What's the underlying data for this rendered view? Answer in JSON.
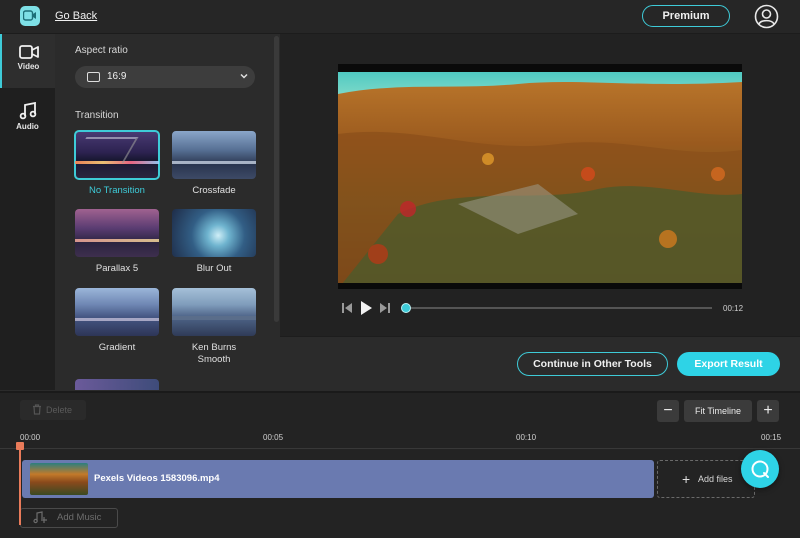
{
  "header": {
    "back_label": "Go Back",
    "premium_label": "Premium"
  },
  "rail": {
    "items": [
      {
        "label": "Video",
        "icon": "video-camera-icon",
        "active": true
      },
      {
        "label": "Audio",
        "icon": "music-note-icon",
        "active": false
      }
    ]
  },
  "panel": {
    "aspect_title": "Aspect ratio",
    "aspect_value": "16:9",
    "transition_title": "Transition",
    "transitions": [
      {
        "label": "No Transition",
        "selected": true
      },
      {
        "label": "Crossfade",
        "selected": false
      },
      {
        "label": "Parallax 5",
        "selected": false
      },
      {
        "label": "Blur Out",
        "selected": false
      },
      {
        "label": "Gradient",
        "selected": false
      },
      {
        "label": "Ken Burns Smooth",
        "selected": false
      }
    ]
  },
  "player": {
    "duration": "00:12",
    "progress": 0
  },
  "actions": {
    "continue_label": "Continue in Other Tools",
    "export_label": "Export Result"
  },
  "timeline": {
    "delete_label": "Delete",
    "fit_label": "Fit Timeline",
    "zoom_out_symbol": "−",
    "zoom_in_symbol": "+",
    "ticks": [
      "00:00",
      "00:05",
      "00:10",
      "00:15"
    ],
    "clip_name": "Pexels Videos 1583096.mp4",
    "add_files_label": "Add files",
    "add_music_label": "Add Music"
  },
  "colors": {
    "accent": "#2ed3e6",
    "clip": "#6a7ab0",
    "playhead": "#e97b5a"
  }
}
